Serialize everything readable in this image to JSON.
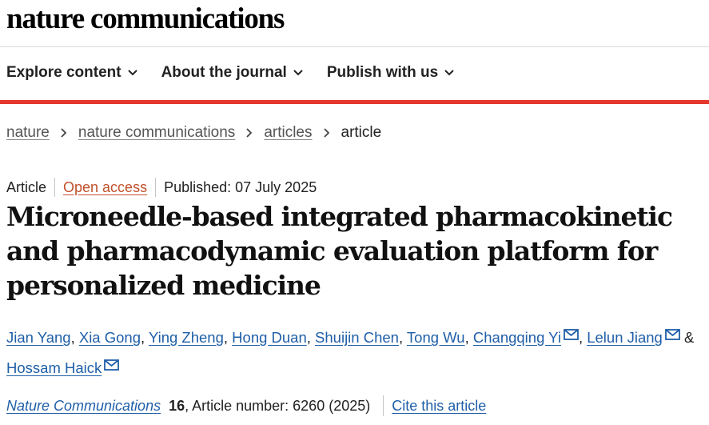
{
  "header": {
    "logo": "nature communications"
  },
  "nav": {
    "items": [
      {
        "label": "Explore content"
      },
      {
        "label": "About the journal"
      },
      {
        "label": "Publish with us"
      }
    ]
  },
  "breadcrumb": {
    "items": [
      "nature",
      "nature communications",
      "articles"
    ],
    "current": "article"
  },
  "article": {
    "type": "Article",
    "access": "Open access",
    "published": "Published: 07 July 2025",
    "title": "Microneedle-based integrated pharmacokinetic and pharmacodynamic evaluation platform for personalized medicine",
    "authors": [
      {
        "name": "Jian Yang",
        "sep": ", "
      },
      {
        "name": "Xia Gong",
        "sep": ", "
      },
      {
        "name": "Ying Zheng",
        "sep": ", "
      },
      {
        "name": "Hong Duan",
        "sep": ", "
      },
      {
        "name": "Shuijin Chen",
        "sep": ", "
      },
      {
        "name": "Tong Wu",
        "sep": ", "
      },
      {
        "name": "Changqing Yi",
        "sep": ", "
      },
      {
        "name": "Lelun Jiang",
        "sep": " & "
      },
      {
        "name": "Hossam Haick",
        "sep": ""
      }
    ],
    "citation": {
      "journal": "Nature Communications",
      "volume": "16",
      "rest": ", Article number: 6260 (2025)",
      "cite_label": "Cite this article"
    }
  },
  "colors": {
    "accent_red": "#e5382c",
    "link_blue": "#1f5fa8",
    "open_access": "#c0502a"
  }
}
